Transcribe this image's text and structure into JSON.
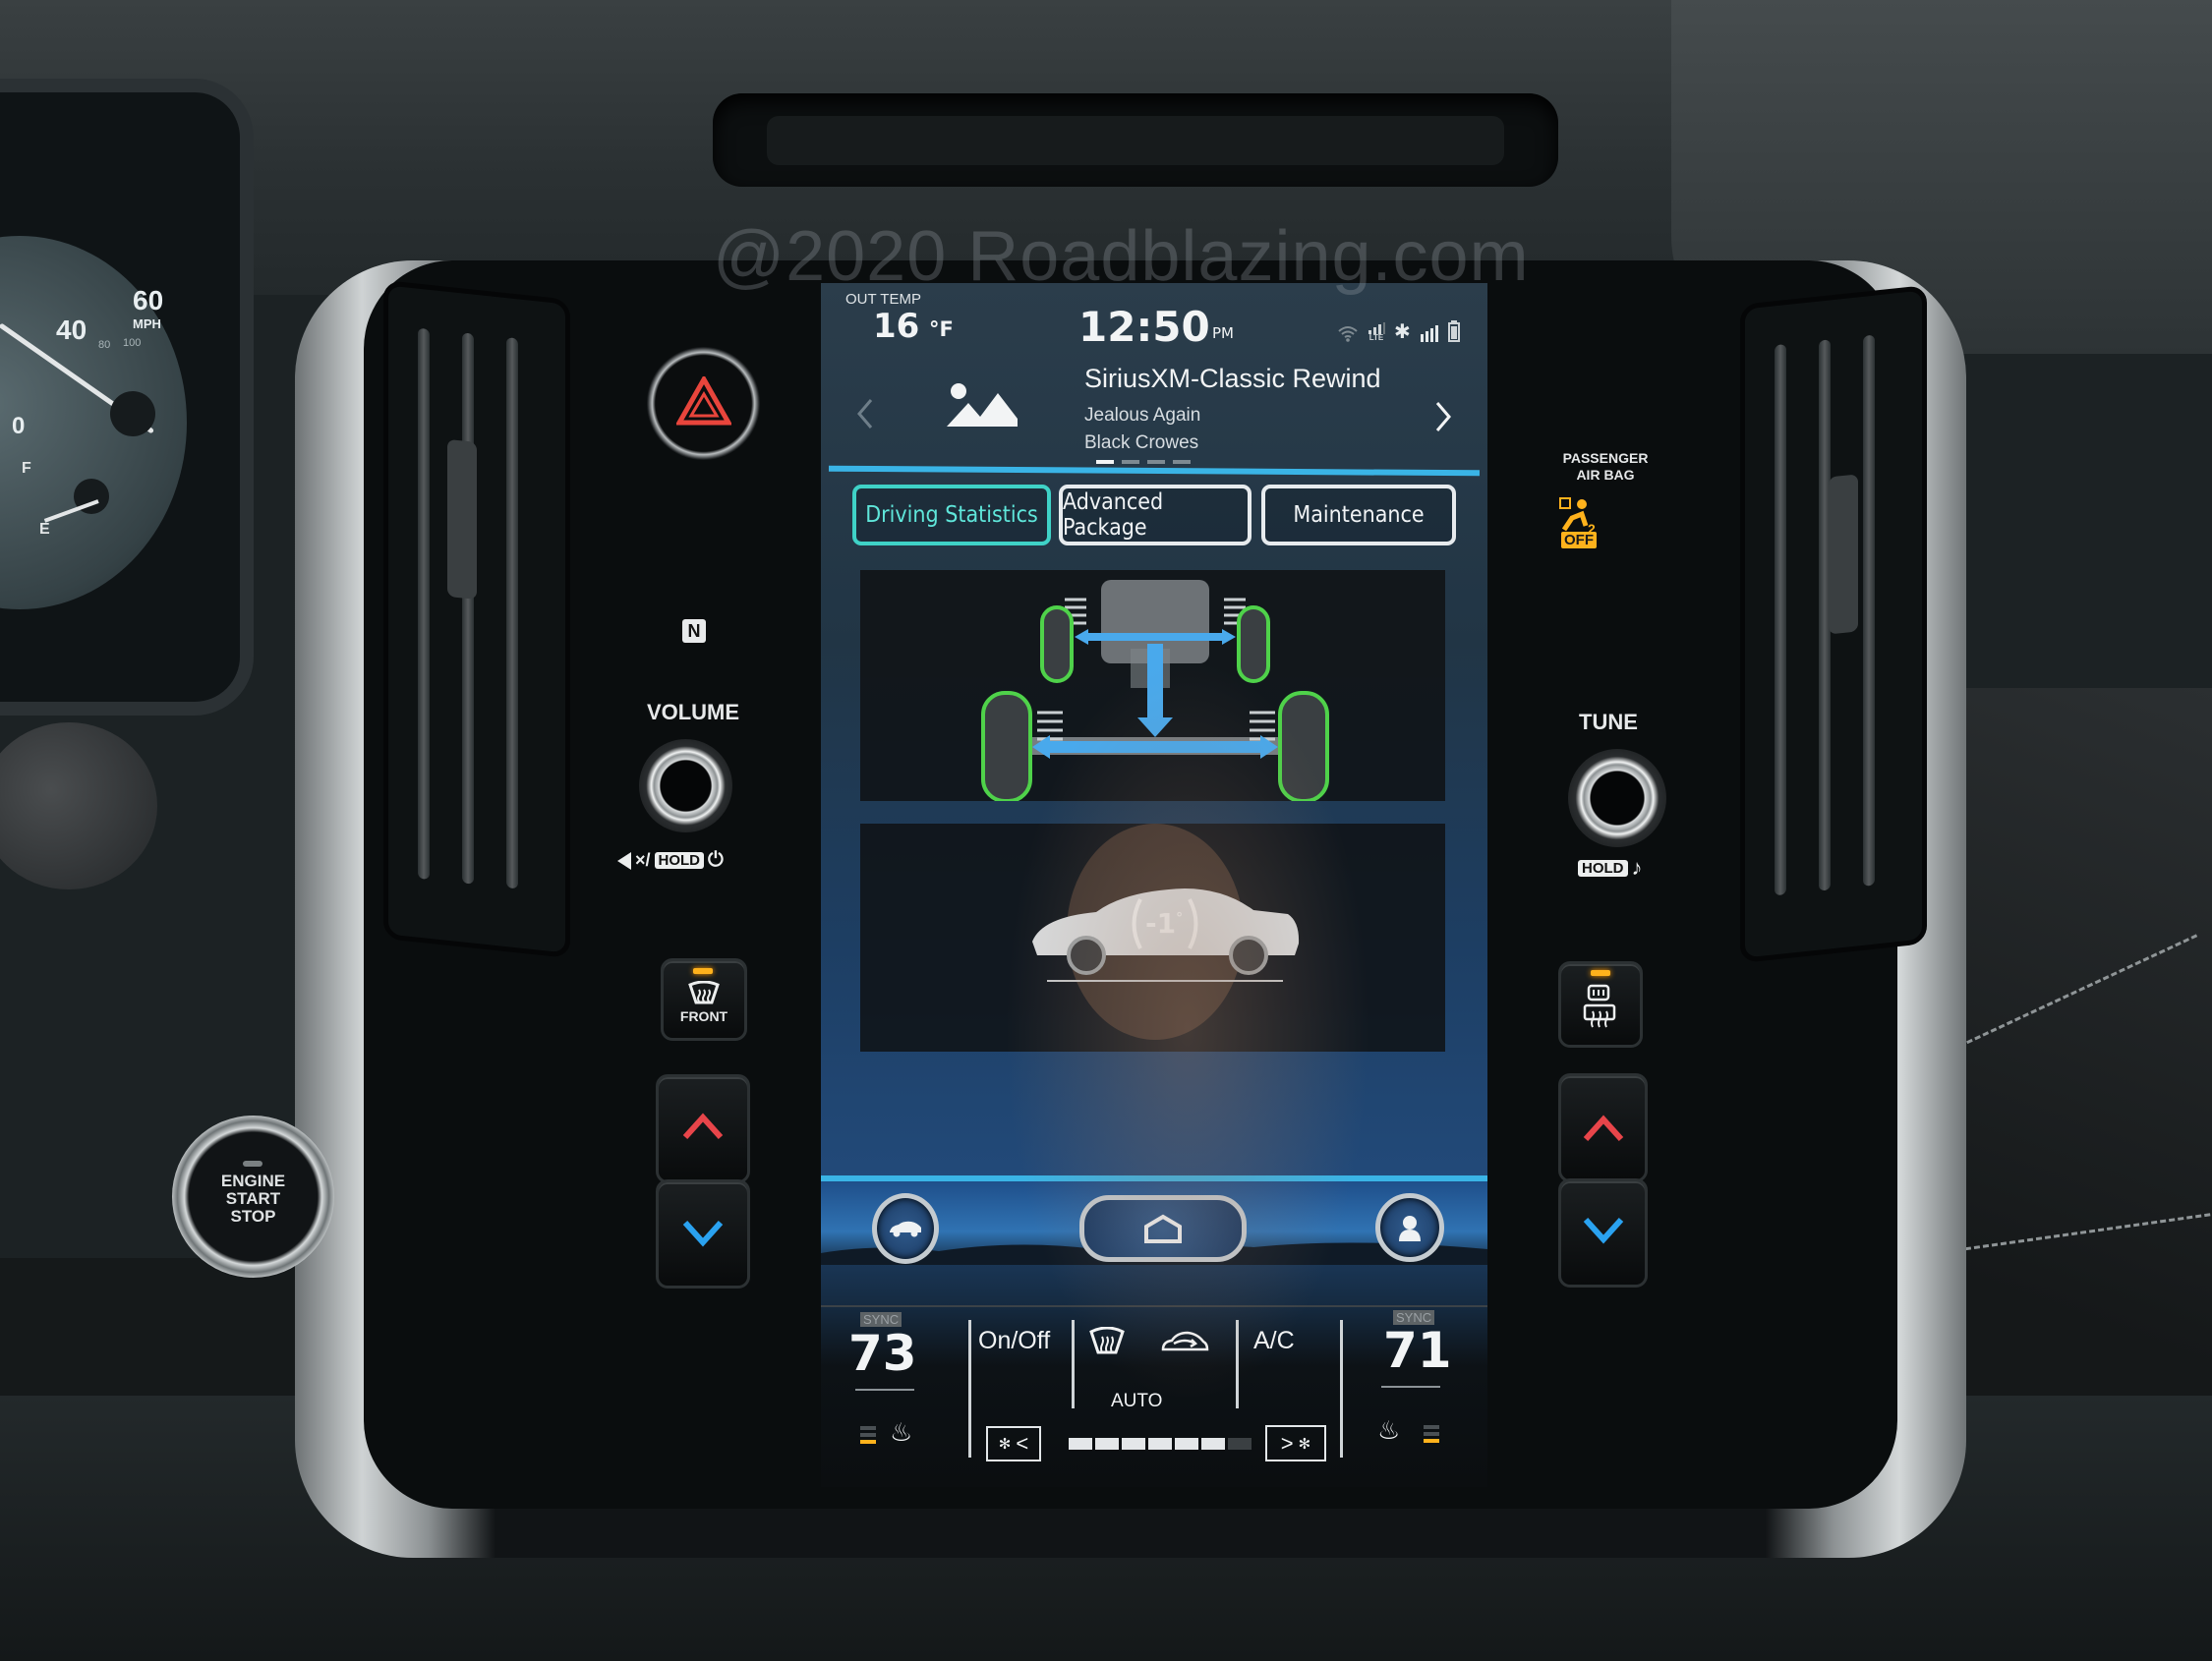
{
  "watermark": "@2020 Roadblazing.com",
  "cluster": {
    "speed_labels": [
      "40",
      "60",
      "0"
    ],
    "speed_unit": "MPH",
    "secondary_labels": [
      "60",
      "80",
      "100"
    ],
    "fuel_full": "F",
    "fuel_empty": "E"
  },
  "left_controls": {
    "hazard_label": "",
    "nfc_label": "N",
    "volume_label": "VOLUME",
    "volume_hint_mute": "×/",
    "volume_hint_hold": "HOLD",
    "defrost_front_label": "FRONT",
    "defrost_front_led_on": true
  },
  "right_controls": {
    "airbag_label_line1": "PASSENGER",
    "airbag_label_line2": "AIR BAG",
    "airbag_status": "OFF",
    "tune_label": "TUNE",
    "tune_hint_hold": "HOLD",
    "defrost_rear_led_on": true
  },
  "engine_button": {
    "line1": "ENGINE",
    "line2": "START",
    "line3": "STOP"
  },
  "status_bar": {
    "out_temp_label": "OUT TEMP",
    "out_temp_value": "16",
    "out_temp_unit": "°F",
    "time": "12:50",
    "ampm": "PM",
    "icons": [
      "wifi-icon",
      "lte-signal-icon",
      "bluetooth-icon",
      "cell-signal-icon",
      "battery-icon"
    ],
    "lte_label": "LTE"
  },
  "media": {
    "station": "SiriusXM-Classic Rewind",
    "song": "Jealous Again",
    "artist": "Black Crowes",
    "page_count": 4,
    "active_page": 1
  },
  "tabs": [
    {
      "label": "Driving Statistics",
      "active": true
    },
    {
      "label": "Advanced Package",
      "active": false
    },
    {
      "label": "Maintenance",
      "active": false
    }
  ],
  "awd_panel": {
    "description": "AWD torque distribution diagram"
  },
  "pitch_panel": {
    "angle": "-1",
    "degree_symbol": "°"
  },
  "nav_bar": {
    "left_icon": "car-icon",
    "center_icon": "home-icon",
    "right_icon": "profile-icon"
  },
  "climate": {
    "driver_sync_label": "SYNC",
    "driver_temp": "73",
    "passenger_sync_label": "SYNC",
    "passenger_temp": "71",
    "on_off_label": "On/Off",
    "auto_label": "AUTO",
    "ac_label": "A/C",
    "fan_level": 6,
    "fan_max": 7,
    "fan_down_label": "<",
    "fan_up_label": ">",
    "driver_seat_heat_level": 1,
    "passenger_seat_heat_level": 1,
    "seat_heat_max": 3
  },
  "colors": {
    "accent_blue": "#3ab4e6",
    "active_tab": "#3fd2c7",
    "awd_wheel_green": "#4fd24a",
    "awd_arrow_blue": "#49a9ec",
    "indicator_amber": "#ffb21c",
    "hazard_red": "#e8453c",
    "up_arrow_red": "#e8454a",
    "down_arrow_blue": "#2aa2f0"
  }
}
